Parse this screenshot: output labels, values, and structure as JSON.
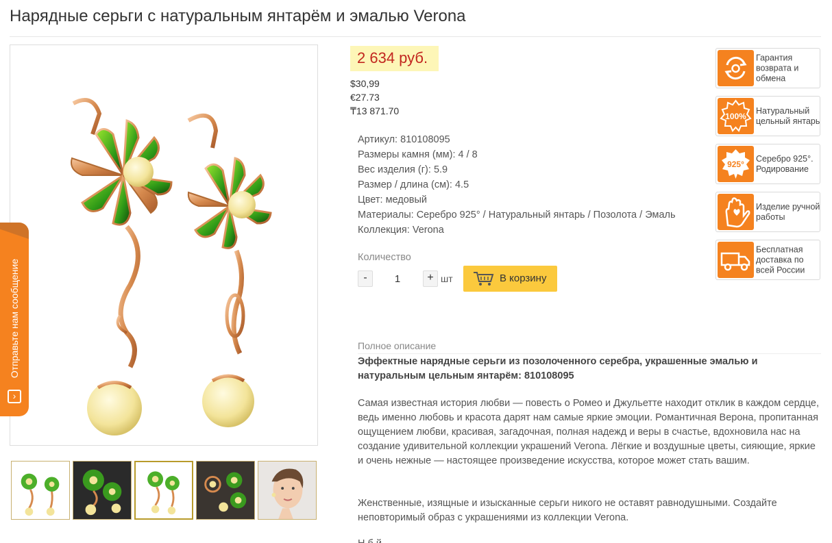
{
  "product": {
    "title": "Нарядные серьги с натуральным янтарём и эмалью Verona",
    "price": "2 634 руб.",
    "alt_prices": [
      "$30,99",
      "€27.73",
      "₸13 871.70"
    ]
  },
  "specs": [
    {
      "label": "Артикул:",
      "value": "810108095"
    },
    {
      "label": "Размеры камня (мм):",
      "value": "4 / 8"
    },
    {
      "label": "Вес изделия (г):",
      "value": "5.9"
    },
    {
      "label": "Размер / длина (см):",
      "value": "4.5"
    },
    {
      "label": "Цвет:",
      "value": "медовый"
    },
    {
      "label": "Материалы:",
      "value": "Серебро 925° / Натуральный янтарь / Позолота / Эмаль"
    },
    {
      "label": "Коллекция:",
      "value": "Verona"
    }
  ],
  "purchase": {
    "qty_label": "Количество",
    "minus": "-",
    "plus": "+",
    "quantity": "1",
    "unit": "шт",
    "cart_button": "В корзину"
  },
  "feedback": {
    "label": "Отправьте нам сообщение",
    "icon": "chevron-right-icon"
  },
  "description": {
    "label": "Полное описание",
    "heading": "Эффектные нарядные серьги из позолоченного серебра, украшенные эмалью и натуральным цельным янтарём: 810108095",
    "p1": "Самая известная история любви — повесть о Ромео и Джульетте находит отклик в каждом сердце, ведь именно любовь и красота дарят нам самые яркие эмоции. Романтичная Верона, пропитанная ощущением любви, красивая, загадочная, полная надежд и веры в счастье, вдохновила нас на создание удивительной коллекции украшений Verona. Лёгкие и воздушные цветы, сияющие, яркие и очень нежные — настоящее произведение искусства, которое может стать вашим.",
    "p2": "Женственные, изящные и изысканные серьги никого не оставят равнодушными. Создайте неповторимый образ с украшениями из коллекции Verona.",
    "p3": "Н                                        б              й"
  },
  "badges": [
    {
      "text": "Гарантия возврата и обмена",
      "icon": "exchange-icon"
    },
    {
      "text": "Натуральный цельный янтарь",
      "icon": "100-percent-icon",
      "icon_text": "100%"
    },
    {
      "text": "Серебро 925°. Родирование",
      "icon": "silver-925-icon",
      "icon_text": "925°"
    },
    {
      "text": "Изделие ручной работы",
      "icon": "hand-heart-icon"
    },
    {
      "text": "Бесплатная доставка по всей России",
      "icon": "delivery-truck-icon"
    }
  ],
  "thumbnails": [
    {
      "name": "earrings-white-bg",
      "active": false
    },
    {
      "name": "earrings-dark-bg",
      "active": false
    },
    {
      "name": "earrings-white-bg-2",
      "active": true
    },
    {
      "name": "jewelry-set-dark",
      "active": false
    },
    {
      "name": "model-wearing",
      "active": false
    }
  ],
  "colors": {
    "accent_orange": "#f5821f",
    "price_red": "#c2261f",
    "price_bg": "#fdf6b7",
    "cart_yellow": "#fbc93d",
    "thumb_border": "#c8b070"
  }
}
